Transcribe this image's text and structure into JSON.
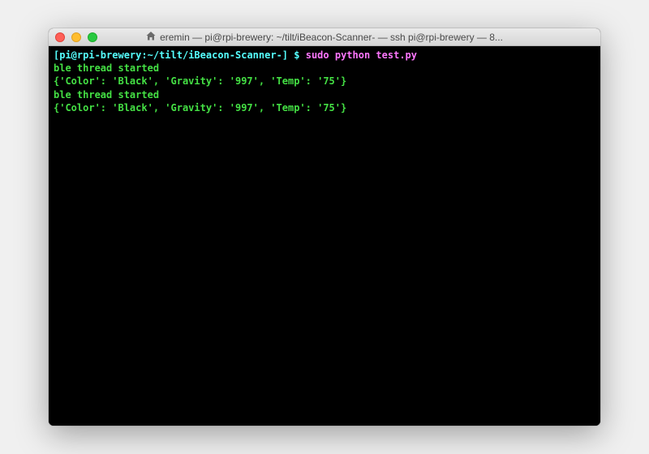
{
  "window": {
    "title": "eremin — pi@rpi-brewery: ~/tilt/iBeacon-Scanner- — ssh pi@rpi-brewery — 8..."
  },
  "prompt": {
    "open": "[",
    "user_host": "pi@rpi-brewery",
    "colon": ":",
    "path": "~/tilt/iBeacon-Scanner-",
    "close_dollar": " $ ",
    "bracket_close": "]"
  },
  "command": "sudo python test.py",
  "output": [
    "ble thread started",
    "{'Color': 'Black', 'Gravity': '997', 'Temp': '75'}",
    "ble thread started",
    "{'Color': 'Black', 'Gravity': '997', 'Temp': '75'}"
  ]
}
